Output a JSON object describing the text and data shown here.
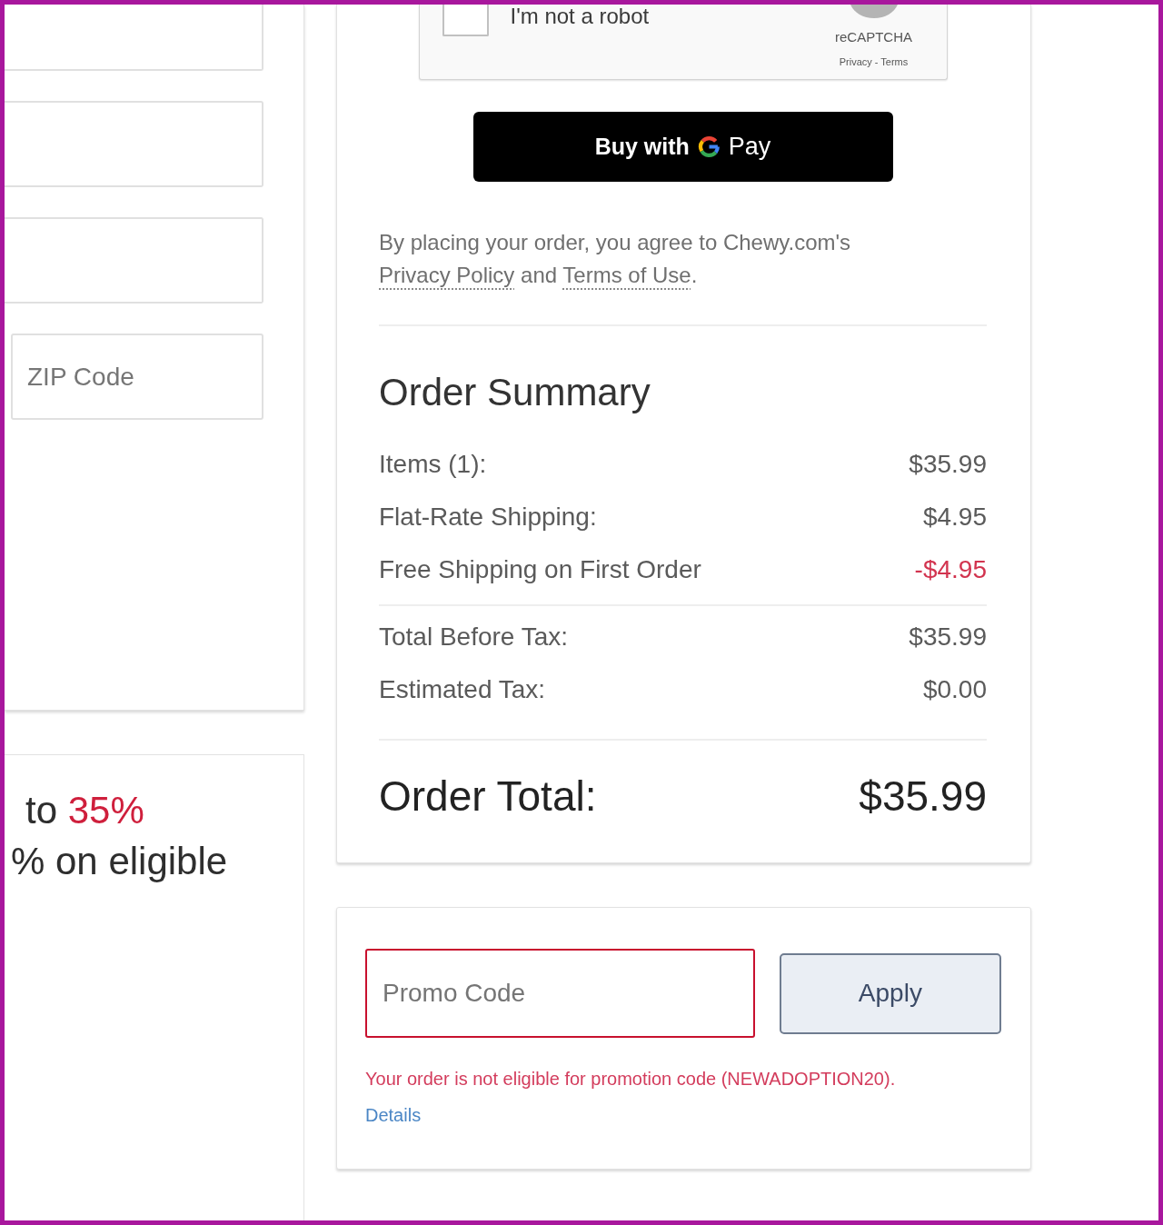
{
  "address_form": {
    "fields": [
      {
        "clipped": true
      },
      {
        "clipped": true
      },
      {
        "clipped": true
      },
      {
        "placeholder": "ZIP Code",
        "clipped": false
      }
    ]
  },
  "promo_banner": {
    "lines": [
      {
        "parts": [
          {
            "text": "to ",
            "accent": false
          },
          {
            "text": "35%",
            "accent": true
          }
        ]
      },
      {
        "parts": [
          {
            "text": "% on eligible",
            "accent": false
          }
        ]
      }
    ]
  },
  "captcha": {
    "checked": false,
    "label": "I'm not a robot",
    "brand": "reCAPTCHA",
    "links": "Privacy - Terms"
  },
  "pay_button": {
    "label_before": "Buy with",
    "label_after": "Pay"
  },
  "agreement": {
    "parts": [
      {
        "text": "By placing your order, you agree to Chewy.com's ",
        "kind": "text"
      },
      {
        "text": "Privacy Policy",
        "kind": "link"
      },
      {
        "text": " and ",
        "kind": "text"
      },
      {
        "text": "Terms of Use",
        "kind": "link"
      },
      {
        "text": ".",
        "kind": "text"
      }
    ]
  },
  "order_summary": {
    "title": "Order Summary",
    "groups": [
      {
        "rows": [
          {
            "label": "Items (1):",
            "value": "$35.99",
            "kind": "charge"
          },
          {
            "label": "Flat-Rate Shipping:",
            "value": "$4.95",
            "kind": "charge"
          },
          {
            "label": "Free Shipping on First Order",
            "value": "-$4.95",
            "kind": "discount"
          }
        ]
      },
      {
        "rows": [
          {
            "label": "Total Before Tax:",
            "value": "$35.99",
            "kind": "charge"
          },
          {
            "label": "Estimated Tax:",
            "value": "$0.00",
            "kind": "charge"
          }
        ]
      }
    ],
    "total": {
      "label": "Order Total:",
      "value": "$35.99"
    }
  },
  "promo": {
    "placeholder": "Promo Code",
    "error": true,
    "button": "Apply",
    "message": "Your order is not eligible for promotion code (NEWADOPTION20).",
    "link": "Details"
  }
}
